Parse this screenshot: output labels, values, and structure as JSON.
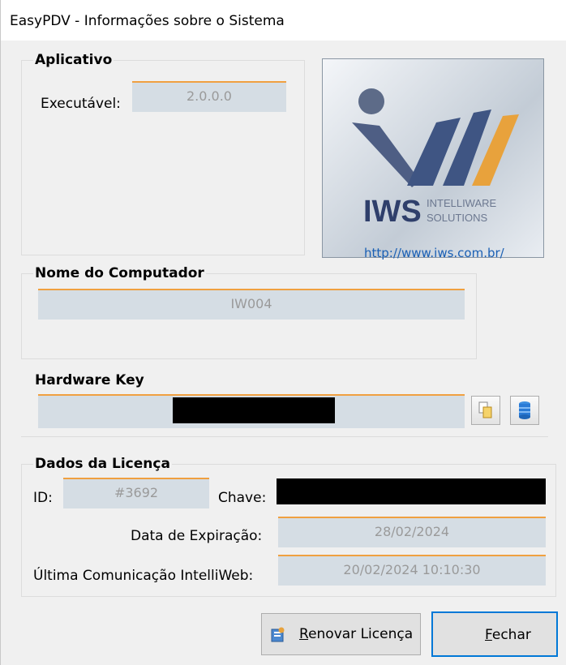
{
  "window": {
    "title": "EasyPDV - Informações sobre o Sistema"
  },
  "aplicativo": {
    "heading": "Aplicativo",
    "executavel_label": "Executável:",
    "executavel_value": "2.0.0.0"
  },
  "logo": {
    "brand": "IWS",
    "tagline_1": "INTELLIWARE",
    "tagline_2": "SOLUTIONS",
    "link": "http://www.iws.com.br/"
  },
  "computador": {
    "heading": "Nome do Computador",
    "value": "IW004"
  },
  "hardware": {
    "heading": "Hardware Key"
  },
  "licenca": {
    "heading": "Dados da Licença",
    "id_label": "ID:",
    "id_value": "#3692",
    "chave_label": "Chave:",
    "expiracao_label": "Data de Expiração:",
    "expiracao_value": "28/02/2024",
    "comunicacao_label": "Última Comunicação IntelliWeb:",
    "comunicacao_value": "20/02/2024 10:10:30"
  },
  "buttons": {
    "renovar_prefix": "",
    "renovar_mnemonic": "R",
    "renovar_rest": "enovar Licença",
    "fechar_mnemonic": "F",
    "fechar_rest": "echar"
  },
  "colors": {
    "field_bg": "#d5dde4",
    "field_accent": "#f0a040",
    "link": "#1a5fb4",
    "default_button_border": "#0078d7"
  }
}
